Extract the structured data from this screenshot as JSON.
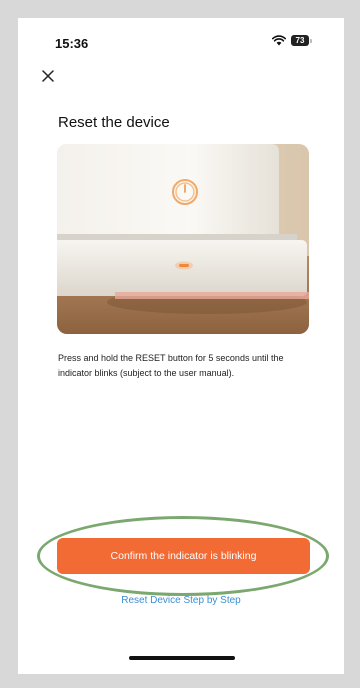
{
  "status_bar": {
    "time": "15:36",
    "battery_level": "73"
  },
  "header": {
    "close_icon": "close-icon"
  },
  "main": {
    "title": "Reset the device",
    "image_icon": "device-photo",
    "instruction": "Press and hold the RESET button for 5 seconds until the indicator blinks (subject to the user manual)."
  },
  "actions": {
    "confirm_label": "Confirm the indicator is blinking",
    "step_by_step_label": "Reset Device Step by Step"
  },
  "colors": {
    "primary": "#f26a34",
    "link": "#3b8fd4",
    "highlight": "#7aa86e"
  }
}
